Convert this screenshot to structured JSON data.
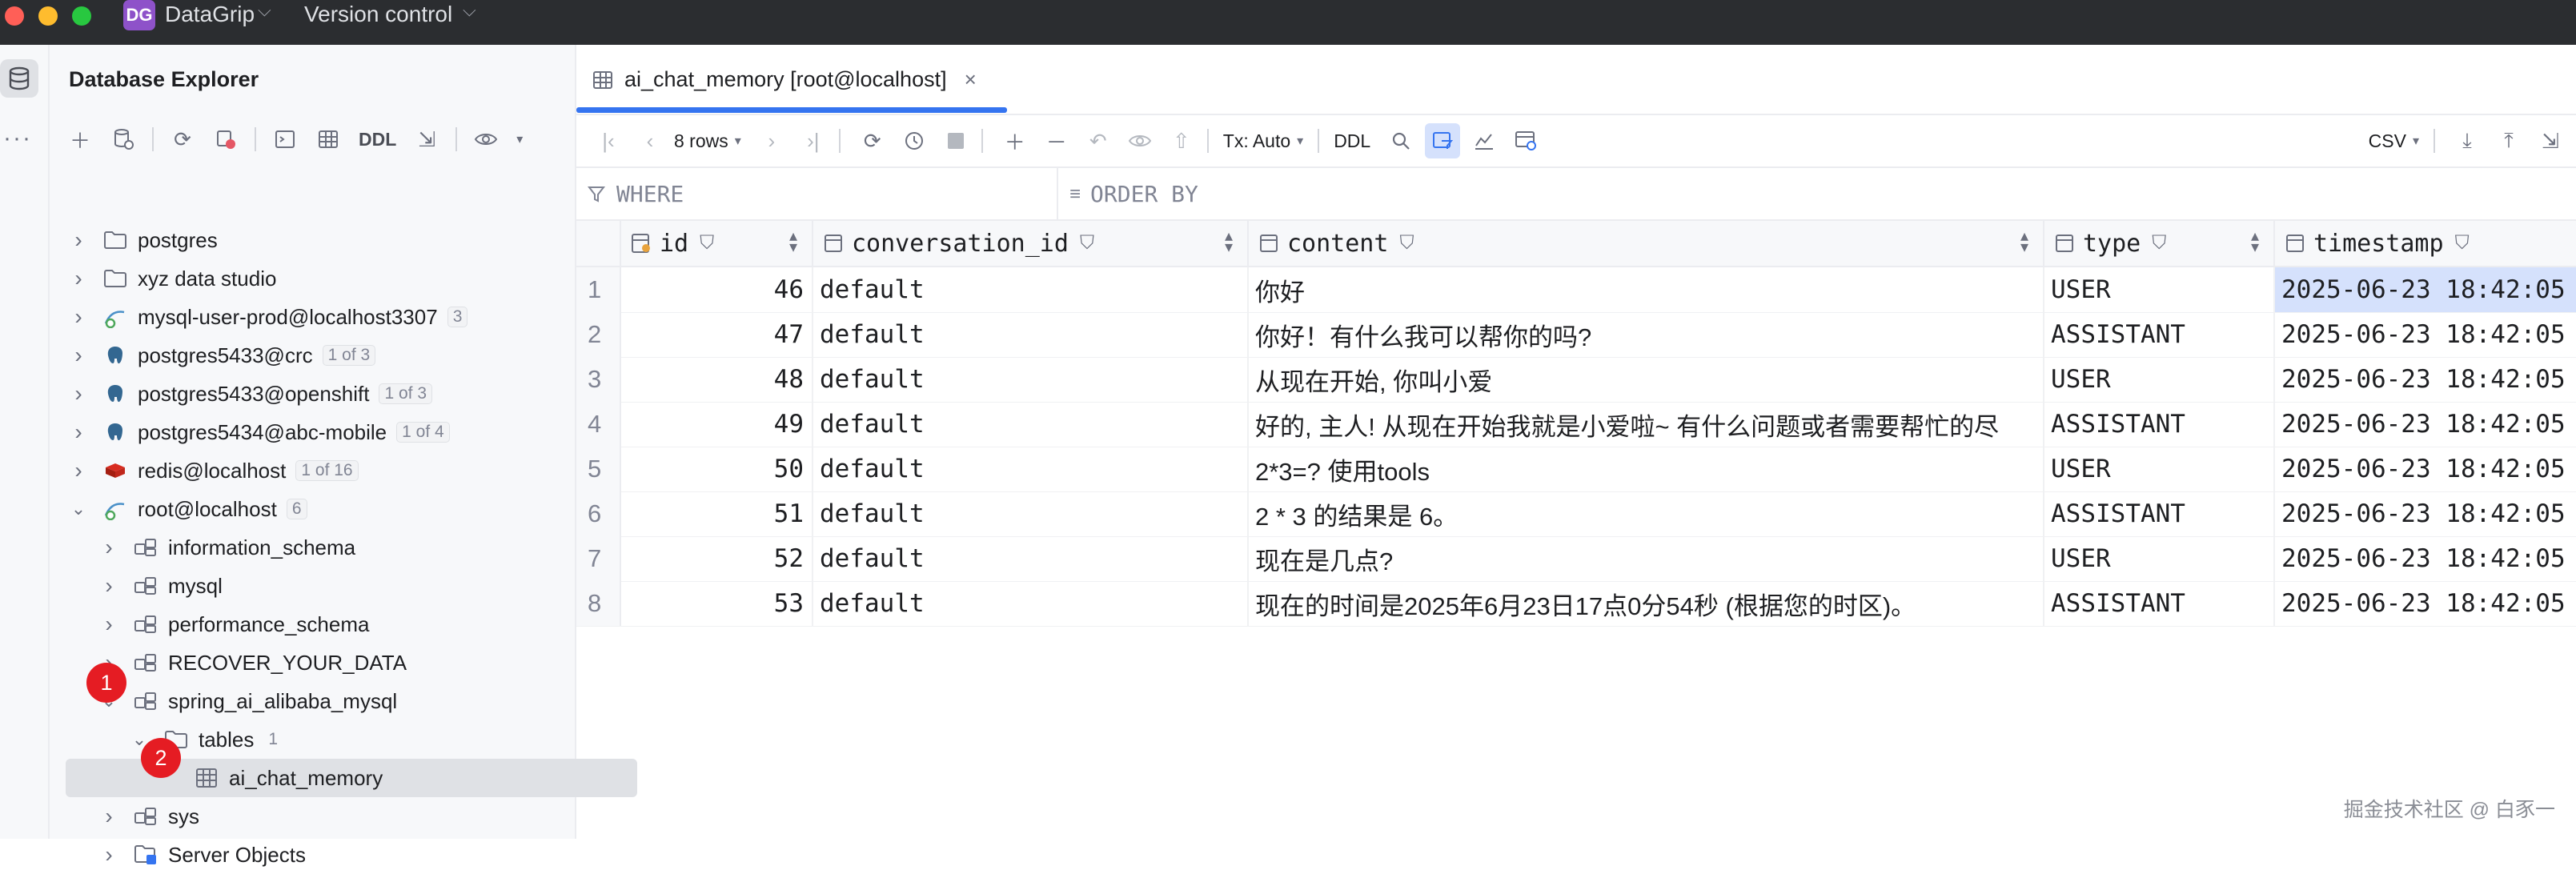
{
  "titlebar": {
    "project_badge": "DG",
    "project_name": "DataGrip",
    "vcs_label": "Version control"
  },
  "explorer": {
    "title": "Database Explorer",
    "toolbar_ddl": "DDL",
    "tree": [
      {
        "label": "postgres",
        "icon": "folder-icon",
        "expanded": false,
        "level": 0
      },
      {
        "label": "xyz data studio",
        "icon": "folder-icon",
        "expanded": false,
        "level": 0
      },
      {
        "label": "mysql-user-prod@localhost3307",
        "icon": "mysql-datasource-icon",
        "count": "3",
        "expanded": false,
        "level": 0
      },
      {
        "label": "postgres5433@crc",
        "icon": "postgres-icon",
        "count": "1 of 3",
        "expanded": false,
        "level": 0
      },
      {
        "label": "postgres5433@openshift",
        "icon": "postgres-icon",
        "count": "1 of 3",
        "expanded": false,
        "level": 0
      },
      {
        "label": "postgres5434@abc-mobile",
        "icon": "postgres-icon",
        "count": "1 of 4",
        "expanded": false,
        "level": 0
      },
      {
        "label": "redis@localhost",
        "icon": "redis-icon",
        "count": "1 of 16",
        "expanded": false,
        "level": 0
      },
      {
        "label": "root@localhost",
        "icon": "mysql-datasource-icon",
        "count": "6",
        "expanded": true,
        "level": 0
      },
      {
        "label": "information_schema",
        "icon": "schema-icon",
        "expanded": false,
        "level": 1
      },
      {
        "label": "mysql",
        "icon": "schema-icon",
        "expanded": false,
        "level": 1
      },
      {
        "label": "performance_schema",
        "icon": "schema-icon",
        "expanded": false,
        "level": 1
      },
      {
        "label": "RECOVER_YOUR_DATA",
        "icon": "schema-icon",
        "expanded": false,
        "level": 1
      },
      {
        "label": "spring_ai_alibaba_mysql",
        "icon": "schema-icon",
        "expanded": true,
        "level": 1
      },
      {
        "label": "tables",
        "icon": "folder-icon",
        "count": "1",
        "expanded": true,
        "level": 2
      },
      {
        "label": "ai_chat_memory",
        "icon": "table-icon",
        "level": 3,
        "selected": true
      },
      {
        "label": "sys",
        "icon": "schema-icon",
        "expanded": false,
        "level": 1
      },
      {
        "label": "Server Objects",
        "icon": "server-objects-icon",
        "expanded": false,
        "level": 1
      }
    ],
    "markers": [
      "1",
      "2"
    ]
  },
  "editor": {
    "tab_label": "ai_chat_memory [root@localhost]",
    "tab_close": "×",
    "rows_label": "8 rows",
    "tx_label": "Tx: Auto",
    "ddl_label": "DDL",
    "export_format": "CSV",
    "where_label": "WHERE",
    "orderby_label": "ORDER BY"
  },
  "table": {
    "columns": [
      "id",
      "conversation_id",
      "content",
      "type",
      "timestamp"
    ],
    "rows": [
      {
        "n": "1",
        "id": "46",
        "conversation_id": "default",
        "content": "你好",
        "type": "USER",
        "timestamp": "2025-06-23 18:42:05"
      },
      {
        "n": "2",
        "id": "47",
        "conversation_id": "default",
        "content": "你好！有什么我可以帮你的吗?",
        "type": "ASSISTANT",
        "timestamp": "2025-06-23 18:42:05"
      },
      {
        "n": "3",
        "id": "48",
        "conversation_id": "default",
        "content": "从现在开始, 你叫小爱",
        "type": "USER",
        "timestamp": "2025-06-23 18:42:05"
      },
      {
        "n": "4",
        "id": "49",
        "conversation_id": "default",
        "content": "好的, 主人! 从现在开始我就是小爱啦~ 有什么问题或者需要帮忙的尽",
        "type": "ASSISTANT",
        "timestamp": "2025-06-23 18:42:05"
      },
      {
        "n": "5",
        "id": "50",
        "conversation_id": "default",
        "content": "2*3=? 使用tools",
        "type": "USER",
        "timestamp": "2025-06-23 18:42:05"
      },
      {
        "n": "6",
        "id": "51",
        "conversation_id": "default",
        "content": "2 * 3 的结果是 6。",
        "type": "ASSISTANT",
        "timestamp": "2025-06-23 18:42:05"
      },
      {
        "n": "7",
        "id": "52",
        "conversation_id": "default",
        "content": "现在是几点?",
        "type": "USER",
        "timestamp": "2025-06-23 18:42:05"
      },
      {
        "n": "8",
        "id": "53",
        "conversation_id": "default",
        "content": "现在的时间是2025年6月23日17点0分54秒 (根据您的时区)。",
        "type": "ASSISTANT",
        "timestamp": "2025-06-23 18:42:05"
      }
    ]
  },
  "watermark": "掘金技术社区 @ 白豕一",
  "colors": {
    "titlebar_bg": "#2b2d30",
    "accent": "#3574f0",
    "selection": "#d5e1fc",
    "marker_red": "#e51c23",
    "badge_purple": "#8e52c9"
  }
}
